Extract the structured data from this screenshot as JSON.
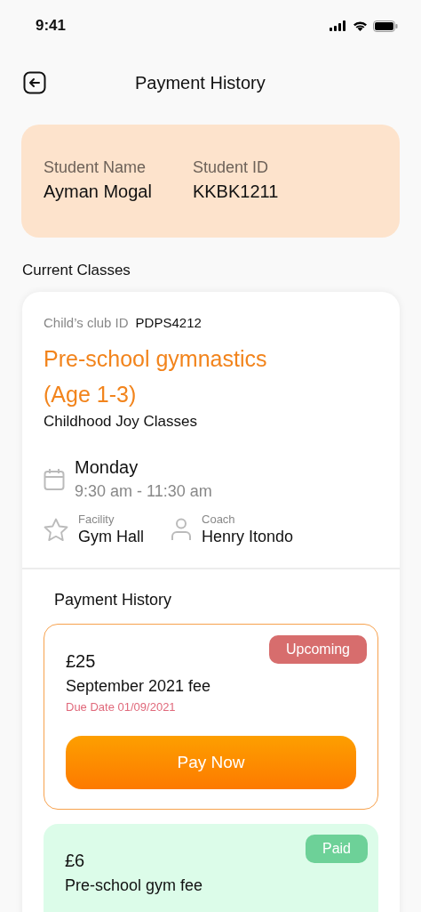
{
  "status_bar": {
    "time": "9:41"
  },
  "header": {
    "title": "Payment History"
  },
  "student": {
    "name_label": "Student Name",
    "name": "Ayman Mogal",
    "id_label": "Student ID",
    "id": "KKBK1211"
  },
  "section_title": "Current Classes",
  "class": {
    "club_id_label": "Child’s club ID",
    "club_id": "PDPS4212",
    "title": "Pre-school gymnastics (Age 1-3)",
    "provider": "Childhood Joy Classes",
    "day": "Monday",
    "time": "9:30 am - 11:30 am",
    "facility_label": "Facility",
    "facility": "Gym Hall",
    "coach_label": "Coach",
    "coach": "Henry Itondo"
  },
  "payments_title": "Payment History",
  "payments": [
    {
      "kind": "upcoming",
      "badge": "Upcoming",
      "amount": "£25",
      "description": "September 2021 fee",
      "due_date": "Due Date 01/09/2021",
      "button": "Pay Now"
    },
    {
      "kind": "paid",
      "badge": "Paid",
      "amount": "£6",
      "description": "Pre-school gym fee"
    }
  ]
}
